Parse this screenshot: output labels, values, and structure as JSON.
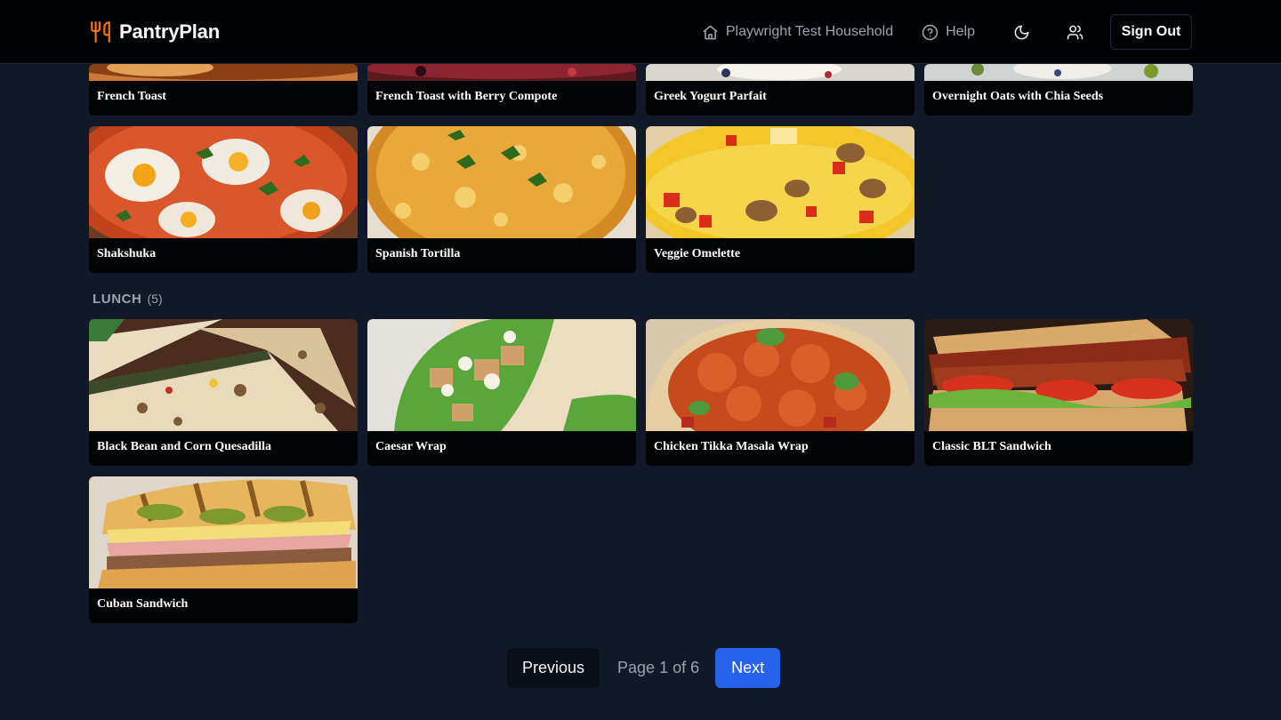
{
  "header": {
    "brand": "PantryPlan",
    "brand_icon": "fork-knife-icon",
    "brand_color": "#f97316",
    "household_label": "Playwright Test Household",
    "help_label": "Help",
    "theme_icon": "moon-icon",
    "users_icon": "users-icon",
    "signout_label": "Sign Out"
  },
  "breakfast": {
    "partial_cards": [
      "French Toast",
      "French Toast with Berry Compote",
      "Greek Yogurt Parfait",
      "Overnight Oats with Chia Seeds"
    ],
    "cards": [
      "Shakshuka",
      "Spanish Tortilla",
      "Veggie Omelette"
    ]
  },
  "lunch": {
    "title": "LUNCH",
    "count": "(5)",
    "cards": [
      "Black Bean and Corn Quesadilla",
      "Caesar Wrap",
      "Chicken Tikka Masala Wrap",
      "Classic BLT Sandwich",
      "Cuban Sandwich"
    ]
  },
  "pagination": {
    "previous_label": "Previous",
    "page_label": "Page 1 of 6",
    "next_label": "Next"
  },
  "colors": {
    "background": "#111827",
    "header": "#020305",
    "accent": "#2563eb"
  }
}
